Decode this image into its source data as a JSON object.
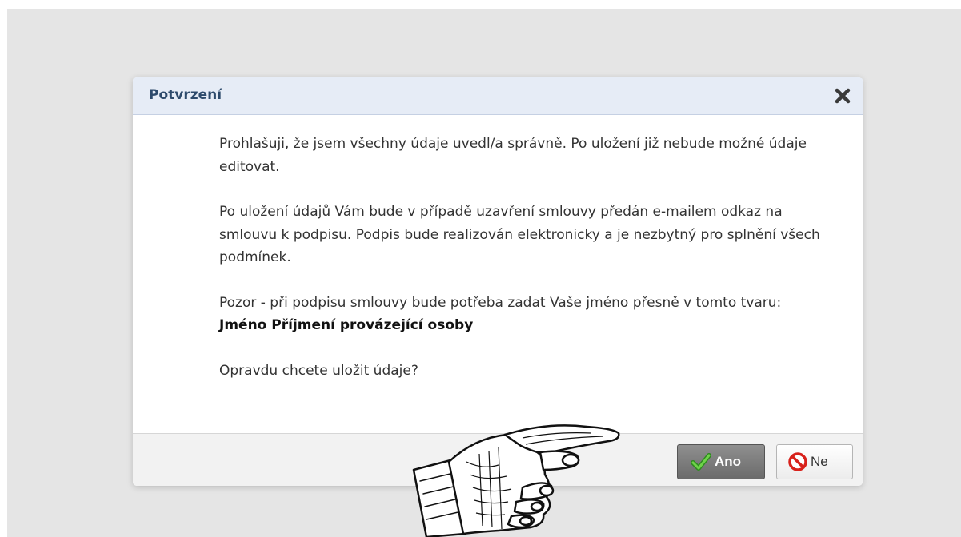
{
  "dialog": {
    "title": "Potvrzení",
    "paragraph_1": "Prohlašuji, že jsem všechny údaje uvedl/a správně. Po uložení již nebude možné údaje editovat.",
    "paragraph_2": "Po uložení údajů Vám bude v případě uzavření smlouvy předán e-mailem odkaz na smlouvu k podpisu. Podpis bude realizován elektronicky a je nezbytný pro splnění všech podmínek.",
    "paragraph_3_prefix": "Pozor - při podpisu smlouvy bude potřeba zadat Vaše jméno přesně v tomto tvaru: ",
    "paragraph_3_name": "Jméno Příjmení provázející osoby",
    "question": "Opravdu chcete uložit údaje?"
  },
  "buttons": {
    "yes_label": "Ano",
    "no_label": "Ne"
  },
  "icons": {
    "close": "close-icon",
    "yes": "checkmark-icon",
    "no": "no-entry-icon",
    "hand": "pointing-hand-icon"
  },
  "colors": {
    "header_bg": "#e6ecf6",
    "title_text": "#2d4a6b",
    "backdrop": "#e5e5e5",
    "yes_button": "#7a7a7a",
    "checkmark": "#4caf2a",
    "no_icon": "#d8221c"
  }
}
